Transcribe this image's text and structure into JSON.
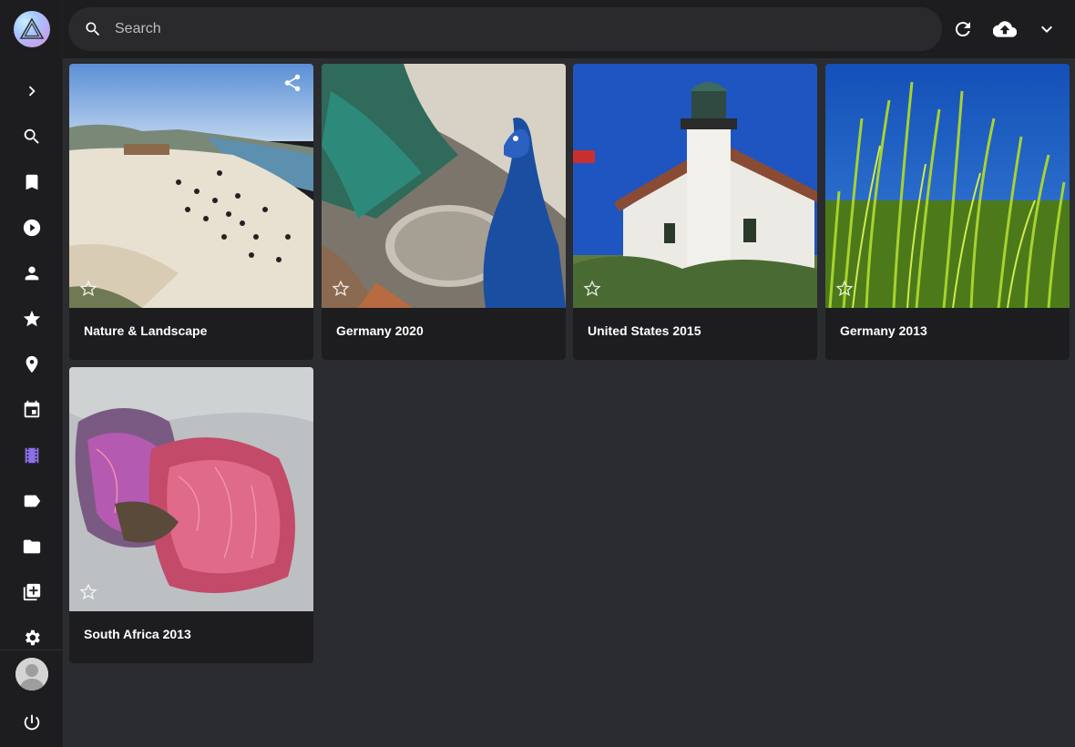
{
  "search": {
    "placeholder": "Search"
  },
  "sidebar": {
    "items": [
      {
        "name": "expand",
        "icon": "chevron-right-icon"
      },
      {
        "name": "search",
        "icon": "search-icon"
      },
      {
        "name": "bookmarks",
        "icon": "bookmark-icon"
      },
      {
        "name": "videos",
        "icon": "play-circle-icon"
      },
      {
        "name": "people",
        "icon": "person-icon"
      },
      {
        "name": "favorites",
        "icon": "star-icon"
      },
      {
        "name": "places",
        "icon": "location-pin-icon"
      },
      {
        "name": "calendar",
        "icon": "calendar-icon"
      },
      {
        "name": "moments",
        "icon": "film-icon"
      },
      {
        "name": "labels",
        "icon": "label-icon"
      },
      {
        "name": "folders",
        "icon": "folder-icon"
      },
      {
        "name": "library",
        "icon": "library-icon"
      },
      {
        "name": "settings",
        "icon": "gear-icon"
      }
    ],
    "active": "moments",
    "accent": "#8b6fe8"
  },
  "toolbar": {
    "buttons": [
      "refresh-icon",
      "cloud-upload-icon",
      "chevron-down-icon"
    ]
  },
  "albums": [
    {
      "title": "Nature & Landscape"
    },
    {
      "title": "Germany 2020"
    },
    {
      "title": "United States 2015"
    },
    {
      "title": "Germany 2013"
    },
    {
      "title": "South Africa 2013"
    }
  ]
}
